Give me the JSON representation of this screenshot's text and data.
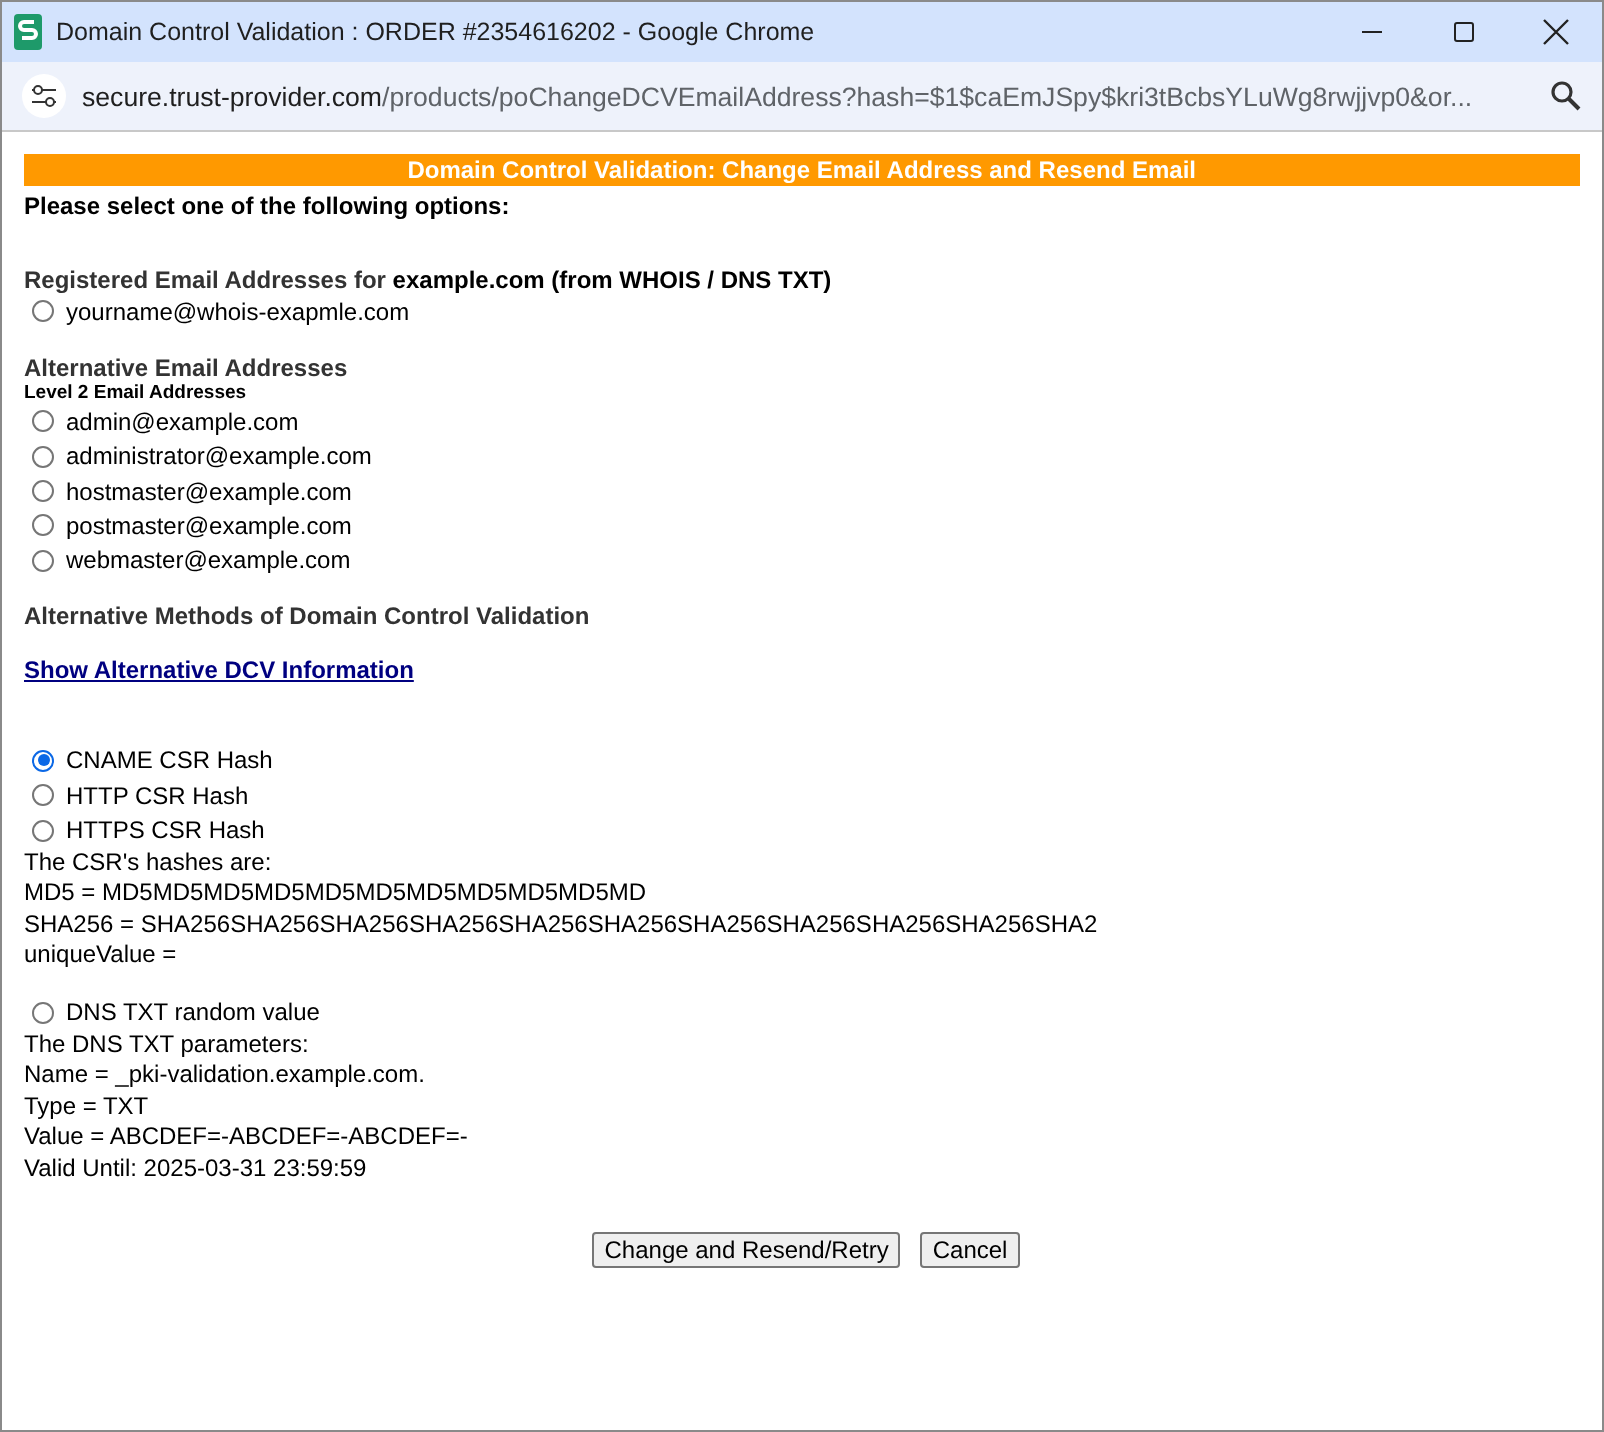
{
  "window": {
    "title": "Domain Control Validation : ORDER #2354616202 - Google Chrome"
  },
  "address_bar": {
    "url_host": "secure.trust-provider.com",
    "url_path": "/products/poChangeDCVEmailAddress?hash=$1$caEmJSpy$kri3tBcbsYLuWg8rwjjvp0&or..."
  },
  "page": {
    "banner": "Domain Control Validation: Change Email Address and Resend Email",
    "prompt": "Please select one of the following options:",
    "registered": {
      "heading": "Registered Email Addresses for **example.com (from WHOIS / DNS TXT)**",
      "options": [
        {
          "label": "yourname@whois-exapmle.com",
          "selected": false
        }
      ]
    },
    "alternative": {
      "heading": "Alternative Email Addresses",
      "subheading": "Level 2 Email Addresses",
      "options": [
        {
          "label": "admin@example.com",
          "selected": false
        },
        {
          "label": "administrator@example.com",
          "selected": false
        },
        {
          "label": "hostmaster@example.com",
          "selected": false
        },
        {
          "label": "postmaster@example.com",
          "selected": false
        },
        {
          "label": "webmaster@example.com",
          "selected": false
        }
      ]
    },
    "methods": {
      "heading": "Alternative Methods of Domain Control Validation",
      "link": "Show Alternative DCV Information",
      "csr_options": [
        {
          "label": "CNAME CSR Hash",
          "selected": true
        },
        {
          "label": "HTTP CSR Hash",
          "selected": false
        },
        {
          "label": "HTTPS CSR Hash",
          "selected": false
        }
      ],
      "csr_lines": [
        "The CSR's hashes are:",
        "MD5 = MD5MD5MD5MD5MD5MD5MD5MD5MD5MD5MD",
        "SHA256 = SHA256SHA256SHA256SHA256SHA256SHA256SHA256SHA256SHA256SHA256SHA2",
        "uniqueValue ="
      ],
      "dns_options": [
        {
          "label": "DNS TXT random value",
          "selected": false
        }
      ],
      "dns_lines": [
        "The DNS TXT parameters:",
        "Name = _pki-validation.example.com.",
        "Type = TXT",
        "Value = ABCDEF=-ABCDEF=-ABCDEF=-",
        "Valid Until: 2025-03-31 23:59:59"
      ]
    },
    "buttons": [
      "Change and Resend/Retry",
      "Cancel"
    ]
  }
}
